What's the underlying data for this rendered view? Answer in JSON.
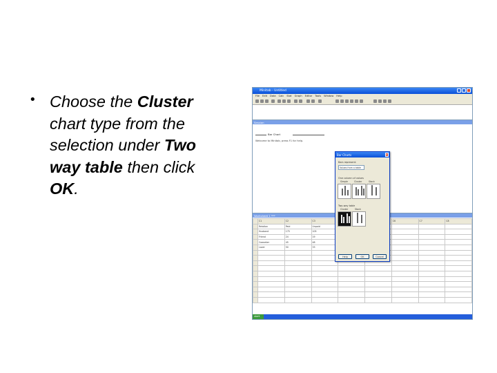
{
  "slide": {
    "bullet_symbol": "•",
    "line1_pre": "Choose the ",
    "line1_bold": "Cluster",
    "line2": "chart type from the",
    "line3_pre": "selection under ",
    "line3_bold": "Two",
    "line4_bold": "way table",
    "line4_post": " then click",
    "line5_bold": "OK",
    "line5_post": "."
  },
  "window": {
    "title": "Minitab - Untitled",
    "menu": [
      "File",
      "Edit",
      "Data",
      "Calc",
      "Stat",
      "Graph",
      "Editor",
      "Tools",
      "Window",
      "Help"
    ]
  },
  "session": {
    "title": "Session",
    "heading": "Bar Chart",
    "line": "Welcome to Minitab, press F1 for help."
  },
  "worksheet": {
    "title": "Worksheet 1 ***",
    "columns": [
      "C1",
      "C2",
      "C3",
      "C4",
      "C5",
      "C6",
      "C7",
      "C8"
    ],
    "col_names": [
      "Relation",
      "Paid",
      "Unpaid",
      "",
      "",
      "",
      "",
      ""
    ],
    "rows": [
      [
        "Husband",
        "175",
        "105"
      ],
      [
        "Friend",
        "24",
        "19"
      ],
      [
        "Coworker",
        "45",
        "48"
      ],
      [
        "Lover",
        "50",
        "33"
      ]
    ]
  },
  "dialog": {
    "title": "Bar Charts",
    "bars_represent_label": "Bars represent:",
    "bars_represent_value": "Values from a table",
    "one_col_label": "One column of values",
    "simple_label": "Simple",
    "cluster_label": "Cluster",
    "stack_label": "Stack",
    "two_way_label": "Two-way table",
    "two_way_cluster_label": "Cluster",
    "two_way_stack_label": "Stack",
    "help_button": "Help",
    "ok_button": "OK",
    "cancel_button": "Cancel"
  },
  "taskbar": {
    "start_label": "start"
  }
}
